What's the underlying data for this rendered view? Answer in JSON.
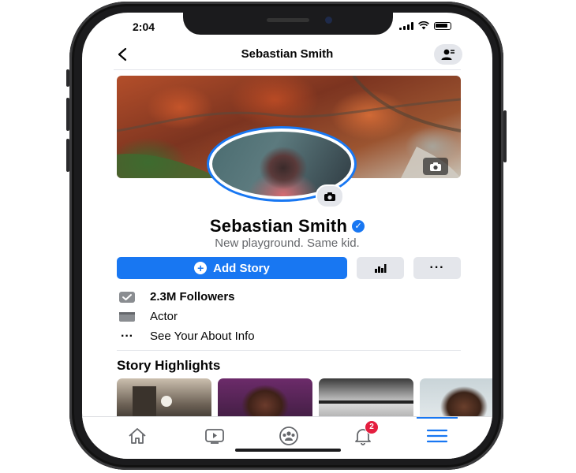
{
  "status_bar": {
    "time": "2:04"
  },
  "header": {
    "title": "Sebastian Smith"
  },
  "profile": {
    "name": "Sebastian Smith",
    "bio": "New playground. Same kid."
  },
  "actions": {
    "add_story_label": "Add Story",
    "more_label": "···"
  },
  "info": {
    "followers": "2.3M Followers",
    "occupation": "Actor",
    "see_about": "See Your About Info",
    "see_about_icon": "···"
  },
  "highlights": {
    "title": "Story Highlights"
  },
  "tabbar": {
    "notification_badge": "2"
  },
  "colors": {
    "accent": "#1877f2",
    "badge": "#e41e3f",
    "button_gray": "#e4e6eb"
  },
  "icons": [
    "back-icon",
    "profile-switch-icon",
    "camera-icon",
    "verified-icon",
    "plus-icon",
    "insights-icon",
    "followers-icon",
    "occupation-icon",
    "home-icon",
    "watch-icon",
    "groups-icon",
    "notifications-icon",
    "menu-icon"
  ]
}
